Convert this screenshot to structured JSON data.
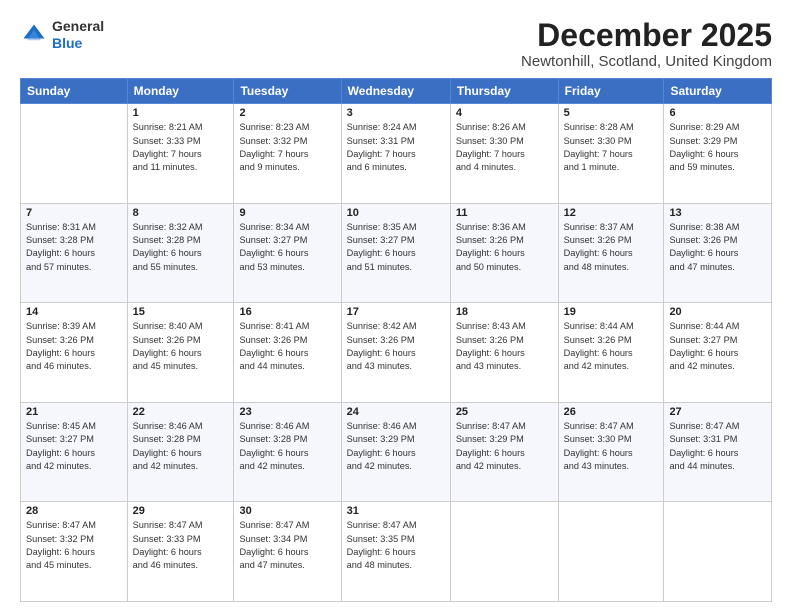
{
  "logo": {
    "general": "General",
    "blue": "Blue"
  },
  "header": {
    "month": "December 2025",
    "location": "Newtonhill, Scotland, United Kingdom"
  },
  "days_of_week": [
    "Sunday",
    "Monday",
    "Tuesday",
    "Wednesday",
    "Thursday",
    "Friday",
    "Saturday"
  ],
  "weeks": [
    [
      {
        "day": "",
        "info": ""
      },
      {
        "day": "1",
        "info": "Sunrise: 8:21 AM\nSunset: 3:33 PM\nDaylight: 7 hours\nand 11 minutes."
      },
      {
        "day": "2",
        "info": "Sunrise: 8:23 AM\nSunset: 3:32 PM\nDaylight: 7 hours\nand 9 minutes."
      },
      {
        "day": "3",
        "info": "Sunrise: 8:24 AM\nSunset: 3:31 PM\nDaylight: 7 hours\nand 6 minutes."
      },
      {
        "day": "4",
        "info": "Sunrise: 8:26 AM\nSunset: 3:30 PM\nDaylight: 7 hours\nand 4 minutes."
      },
      {
        "day": "5",
        "info": "Sunrise: 8:28 AM\nSunset: 3:30 PM\nDaylight: 7 hours\nand 1 minute."
      },
      {
        "day": "6",
        "info": "Sunrise: 8:29 AM\nSunset: 3:29 PM\nDaylight: 6 hours\nand 59 minutes."
      }
    ],
    [
      {
        "day": "7",
        "info": "Sunrise: 8:31 AM\nSunset: 3:28 PM\nDaylight: 6 hours\nand 57 minutes."
      },
      {
        "day": "8",
        "info": "Sunrise: 8:32 AM\nSunset: 3:28 PM\nDaylight: 6 hours\nand 55 minutes."
      },
      {
        "day": "9",
        "info": "Sunrise: 8:34 AM\nSunset: 3:27 PM\nDaylight: 6 hours\nand 53 minutes."
      },
      {
        "day": "10",
        "info": "Sunrise: 8:35 AM\nSunset: 3:27 PM\nDaylight: 6 hours\nand 51 minutes."
      },
      {
        "day": "11",
        "info": "Sunrise: 8:36 AM\nSunset: 3:26 PM\nDaylight: 6 hours\nand 50 minutes."
      },
      {
        "day": "12",
        "info": "Sunrise: 8:37 AM\nSunset: 3:26 PM\nDaylight: 6 hours\nand 48 minutes."
      },
      {
        "day": "13",
        "info": "Sunrise: 8:38 AM\nSunset: 3:26 PM\nDaylight: 6 hours\nand 47 minutes."
      }
    ],
    [
      {
        "day": "14",
        "info": "Sunrise: 8:39 AM\nSunset: 3:26 PM\nDaylight: 6 hours\nand 46 minutes."
      },
      {
        "day": "15",
        "info": "Sunrise: 8:40 AM\nSunset: 3:26 PM\nDaylight: 6 hours\nand 45 minutes."
      },
      {
        "day": "16",
        "info": "Sunrise: 8:41 AM\nSunset: 3:26 PM\nDaylight: 6 hours\nand 44 minutes."
      },
      {
        "day": "17",
        "info": "Sunrise: 8:42 AM\nSunset: 3:26 PM\nDaylight: 6 hours\nand 43 minutes."
      },
      {
        "day": "18",
        "info": "Sunrise: 8:43 AM\nSunset: 3:26 PM\nDaylight: 6 hours\nand 43 minutes."
      },
      {
        "day": "19",
        "info": "Sunrise: 8:44 AM\nSunset: 3:26 PM\nDaylight: 6 hours\nand 42 minutes."
      },
      {
        "day": "20",
        "info": "Sunrise: 8:44 AM\nSunset: 3:27 PM\nDaylight: 6 hours\nand 42 minutes."
      }
    ],
    [
      {
        "day": "21",
        "info": "Sunrise: 8:45 AM\nSunset: 3:27 PM\nDaylight: 6 hours\nand 42 minutes."
      },
      {
        "day": "22",
        "info": "Sunrise: 8:46 AM\nSunset: 3:28 PM\nDaylight: 6 hours\nand 42 minutes."
      },
      {
        "day": "23",
        "info": "Sunrise: 8:46 AM\nSunset: 3:28 PM\nDaylight: 6 hours\nand 42 minutes."
      },
      {
        "day": "24",
        "info": "Sunrise: 8:46 AM\nSunset: 3:29 PM\nDaylight: 6 hours\nand 42 minutes."
      },
      {
        "day": "25",
        "info": "Sunrise: 8:47 AM\nSunset: 3:29 PM\nDaylight: 6 hours\nand 42 minutes."
      },
      {
        "day": "26",
        "info": "Sunrise: 8:47 AM\nSunset: 3:30 PM\nDaylight: 6 hours\nand 43 minutes."
      },
      {
        "day": "27",
        "info": "Sunrise: 8:47 AM\nSunset: 3:31 PM\nDaylight: 6 hours\nand 44 minutes."
      }
    ],
    [
      {
        "day": "28",
        "info": "Sunrise: 8:47 AM\nSunset: 3:32 PM\nDaylight: 6 hours\nand 45 minutes."
      },
      {
        "day": "29",
        "info": "Sunrise: 8:47 AM\nSunset: 3:33 PM\nDaylight: 6 hours\nand 46 minutes."
      },
      {
        "day": "30",
        "info": "Sunrise: 8:47 AM\nSunset: 3:34 PM\nDaylight: 6 hours\nand 47 minutes."
      },
      {
        "day": "31",
        "info": "Sunrise: 8:47 AM\nSunset: 3:35 PM\nDaylight: 6 hours\nand 48 minutes."
      },
      {
        "day": "",
        "info": ""
      },
      {
        "day": "",
        "info": ""
      },
      {
        "day": "",
        "info": ""
      }
    ]
  ]
}
